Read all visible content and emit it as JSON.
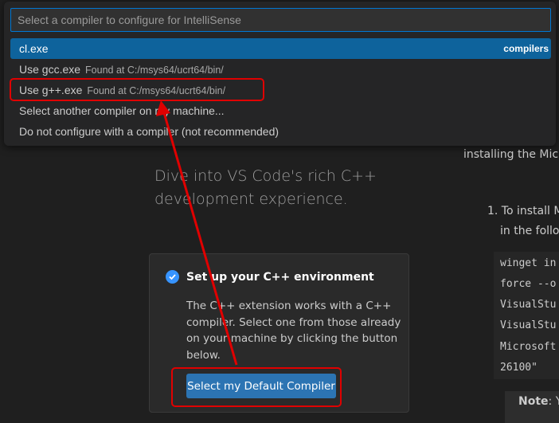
{
  "quick_pick": {
    "placeholder": "Select a compiler to configure for IntelliSense",
    "items": [
      {
        "label": "cl.exe",
        "detail": "",
        "badge": "compilers"
      },
      {
        "label": "Use gcc.exe",
        "detail": "Found at C:/msys64/ucrt64/bin/",
        "badge": ""
      },
      {
        "label": "Use g++.exe",
        "detail": "Found at C:/msys64/ucrt64/bin/",
        "badge": ""
      },
      {
        "label": "Select another compiler on my machine...",
        "detail": "",
        "badge": ""
      },
      {
        "label": "Do not configure with a compiler (not recommended)",
        "detail": "",
        "badge": ""
      }
    ]
  },
  "welcome": {
    "heading": "Dive into VS Code's rich C++ development experience."
  },
  "card": {
    "title": "Set up your C++ environment",
    "text": "The C++ extension works with a C++ compiler. Select one from those already on your machine by clicking the button below.",
    "button_label": "Select my Default Compiler"
  },
  "doc": {
    "line1": "installing the Micro",
    "step1_a": "1. To install M",
    "step1_b": "in the follov",
    "code": [
      "winget in",
      "force --o",
      "VisualStu",
      "VisualStu",
      "Microsoft",
      "26100\""
    ],
    "note_label": "Note",
    "note_rest": ": Y"
  },
  "colors": {
    "accent": "#0e639c",
    "button": "#2c74b3",
    "annotation": "#e00000"
  }
}
